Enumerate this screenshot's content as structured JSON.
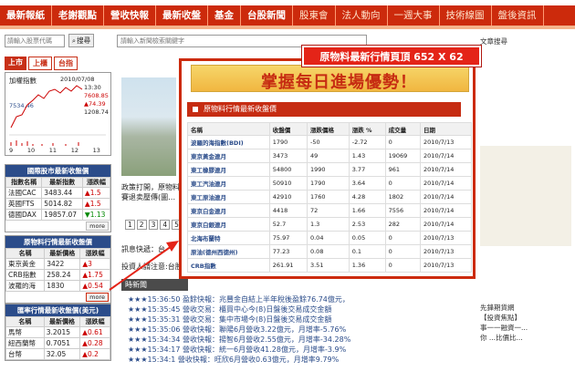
{
  "nav": {
    "items": [
      "最新報紙",
      "老謝觀點",
      "營收快報",
      "最新收盤",
      "基金",
      "台股新聞",
      "股東會",
      "法人動向",
      "一週大事",
      "技術線圖",
      "盤後資訊"
    ]
  },
  "search": {
    "stock_placeholder": "請輸入股票代碼",
    "button_label": "搜尋",
    "news_placeholder": "請輸入新聞檢索關鍵字"
  },
  "market_tabs": [
    "上市",
    "上櫃",
    "台指"
  ],
  "index_chart": {
    "title": "加權指數",
    "date": "2010/07/08",
    "time": "13:30",
    "last": "7608.85",
    "change": "▲74.39",
    "low_mark": "7534.46",
    "scale": "1208.74",
    "x_ticks": [
      "9",
      "10",
      "11",
      "12",
      "13"
    ]
  },
  "intl_index": {
    "title": "國際股市最新收盤價",
    "headers": [
      "指數名稱",
      "最新指數",
      "漲跌幅"
    ],
    "rows": [
      [
        "法國CAC",
        "3483.44",
        "1.5"
      ],
      [
        "英國FTS",
        "5014.82",
        "1.5"
      ],
      [
        "德國DAX",
        "19857.07",
        "1.13"
      ]
    ],
    "more": "more"
  },
  "commodity": {
    "title": "原物料行情最新收盤價",
    "headers": [
      "名稱",
      "最新價格",
      "漲跌幅"
    ],
    "rows": [
      [
        "東京黃金",
        "3422",
        "3"
      ],
      [
        "CRB指數",
        "258.24",
        "1.75"
      ],
      [
        "波羅的海",
        "1830",
        "0.54"
      ]
    ],
    "more": "more"
  },
  "fx": {
    "title": "匯率行情最新收盤價(美元)",
    "headers": [
      "名稱",
      "最新價格",
      "漲跌幅"
    ],
    "rows": [
      [
        "馬幣",
        "3.2015",
        "0.61"
      ],
      [
        "紐西蘭幣",
        "0.7051",
        "0.28"
      ],
      [
        "台幣",
        "32.05",
        "0.2"
      ]
    ]
  },
  "middle": {
    "caption_1": "政策打開，原物料與",
    "caption_2": "賽退卖壓傳(圖…",
    "pages": [
      "1",
      "2",
      "3",
      "4",
      "5"
    ],
    "info_label": "訊息快遞：台",
    "invest_label": "投資人請注意:台股",
    "list_label": "時新聞"
  },
  "news": [
    {
      "stars": "★★★",
      "time": "15:36:50",
      "category": "盈餘快報",
      "text": "：兆豐金自結上半年稅後盈餘76.74億元，"
    },
    {
      "stars": "★★★",
      "time": "15:35:45",
      "category": "營收交易",
      "text": "：櫃買中心今(8)日盤後交易成交金額"
    },
    {
      "stars": "★★★",
      "time": "15:35:31",
      "category": "營收交易",
      "text": "：集中市場今(8)日盤後交易成交金額"
    },
    {
      "stars": "★★★",
      "time": "15:35:06",
      "category": "營收快報",
      "text": "：聯陽6月營收3.22億元，月增率-5.76%"
    },
    {
      "stars": "★★★",
      "time": "15:34:34",
      "category": "營收快報",
      "text": "：揚智6月營收2.55億元，月增率-34.28%"
    },
    {
      "stars": "★★★",
      "time": "15:34:17",
      "category": "營收快報",
      "text": "：統一6月營收41.28億元，月增率-3.9%"
    },
    {
      "stars": "★★★",
      "time": "15:34:1",
      "category": "營收快報",
      "text": "：旺欣6月營收0.63億元，月增率9.79%"
    }
  ],
  "overlay": {
    "banner": "掌握每日進場優勢！",
    "section_title": "原物料行情最新收盤價",
    "callout": "原物料最新行情頁頂 652 X 62",
    "headers": [
      "名稱",
      "收盤價",
      "漲跌價格",
      "漲跌 %",
      "成交量",
      "日期"
    ],
    "rows": [
      [
        "波羅的海指數(BDI)",
        "1790",
        "-50",
        "-2.72",
        "0",
        "2010/7/13"
      ],
      [
        "東京黃金連月",
        "3473",
        "49",
        "1.43",
        "19069",
        "2010/7/14"
      ],
      [
        "東工橡膠連月",
        "54800",
        "1990",
        "3.77",
        "961",
        "2010/7/14"
      ],
      [
        "東工汽油連月",
        "50910",
        "1790",
        "3.64",
        "0",
        "2010/7/14"
      ],
      [
        "東工原油連月",
        "42910",
        "1760",
        "4.28",
        "1802",
        "2010/7/14"
      ],
      [
        "東京白金連月",
        "4418",
        "72",
        "1.66",
        "7556",
        "2010/7/14"
      ],
      [
        "東京白銀連月",
        "52.7",
        "1.3",
        "2.53",
        "282",
        "2010/7/14"
      ],
      [
        "北海布蘭特",
        "75.97",
        "0.04",
        "0.05",
        "0",
        "2010/7/13"
      ],
      [
        "原油(德州西德州)",
        "77.23",
        "0.08",
        "0.1",
        "0",
        "2010/7/13"
      ],
      [
        "CRB指數",
        "261.91",
        "3.51",
        "1.36",
        "0",
        "2010/7/13"
      ]
    ]
  },
  "right": {
    "t1": "文章搜尋",
    "t2": "先鋒期貨網",
    "t3": "【投資焦點】",
    "t4": "事一一融資一...",
    "t5": "你 ...比價比..."
  }
}
